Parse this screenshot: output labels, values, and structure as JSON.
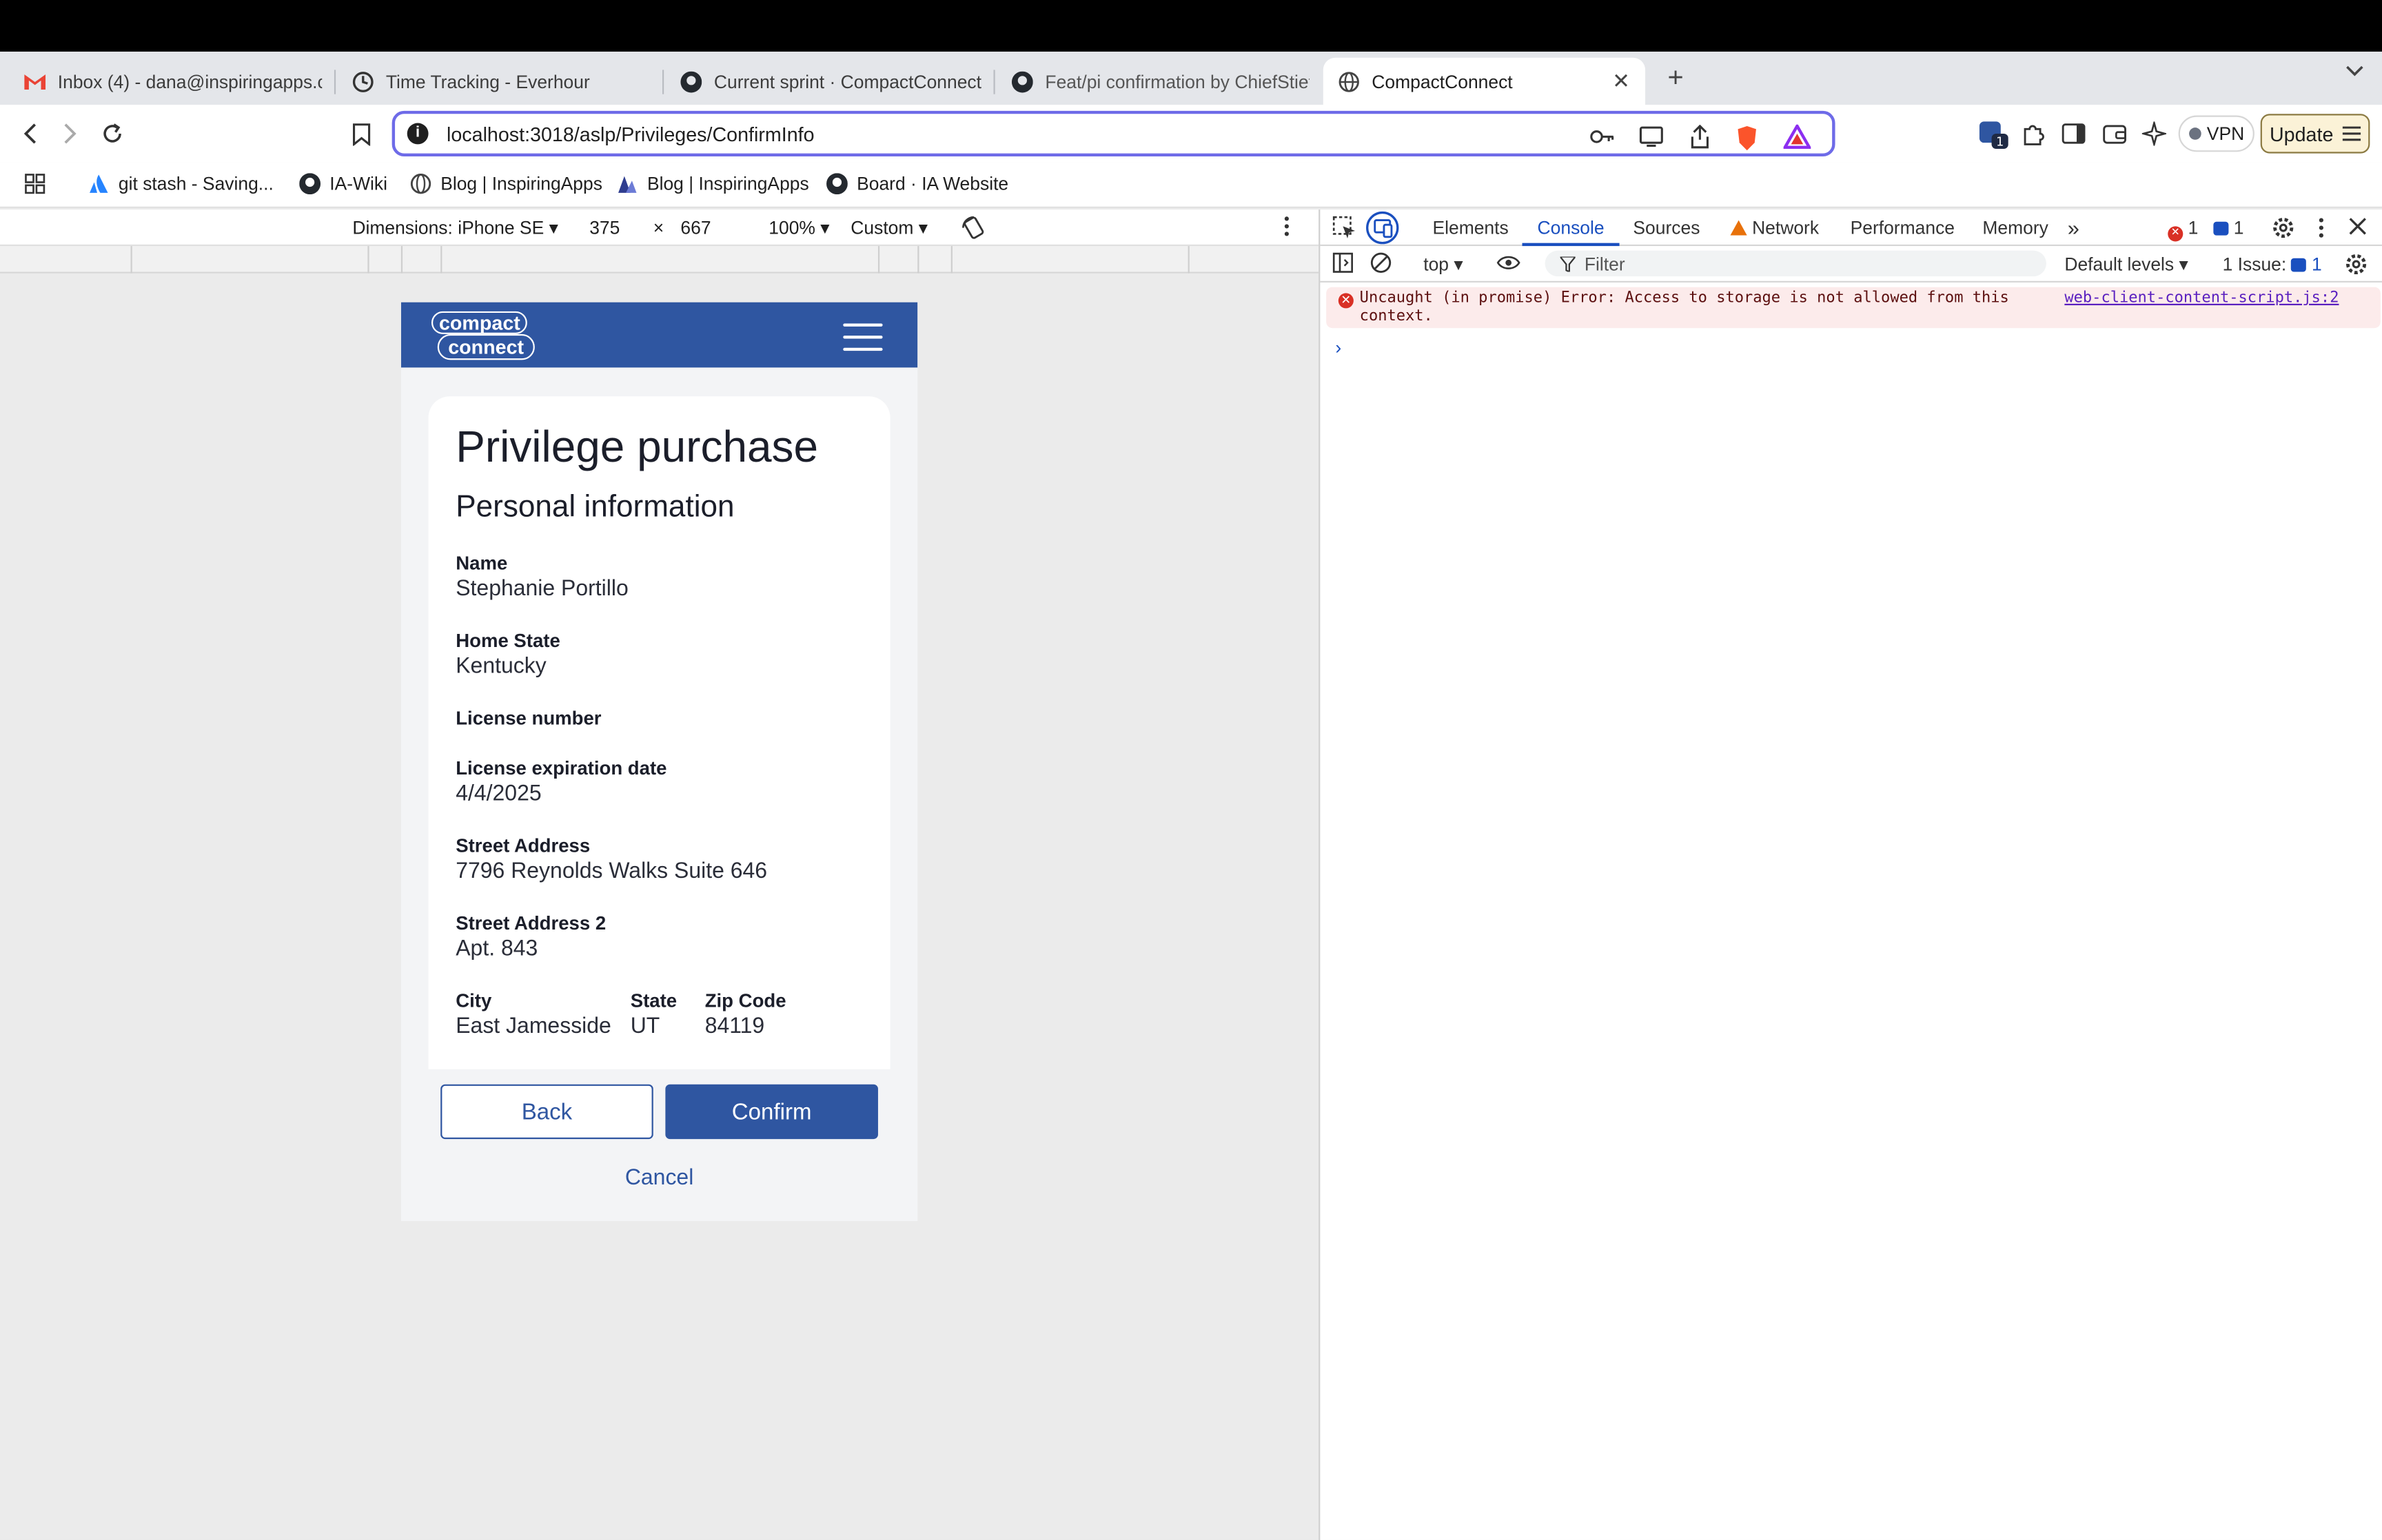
{
  "browser": {
    "tabs": [
      {
        "label": "Inbox (4) - dana@inspiringapps.c",
        "icon": "gmail-icon",
        "active": false
      },
      {
        "label": "Time Tracking - Everhour",
        "icon": "everhour-icon",
        "active": false
      },
      {
        "label": "Current sprint · CompactConnect",
        "icon": "github-icon",
        "active": false
      },
      {
        "label": "Feat/pi confirmation by ChiefStief",
        "icon": "github-icon",
        "active": false
      },
      {
        "label": "CompactConnect",
        "icon": "globe-icon",
        "active": true
      }
    ],
    "url": "localhost:3018/aslp/Privileges/ConfirmInfo",
    "bookmarks": [
      {
        "label": "git stash - Saving...",
        "icon": "atlassian-icon"
      },
      {
        "label": "IA-Wiki",
        "icon": "github-icon"
      },
      {
        "label": "Blog | InspiringApps",
        "icon": "globe-icon"
      },
      {
        "label": "Blog | InspiringApps",
        "icon": "inspiringapps-icon"
      },
      {
        "label": "Board · IA Website",
        "icon": "github-icon"
      }
    ],
    "vpn_label": "VPN",
    "update_label": "Update",
    "extension_badge": "1",
    "accent": "#6e6be8"
  },
  "device_toolbar": {
    "dimensions_label": "Dimensions: iPhone SE",
    "width": "375",
    "times": "×",
    "height": "667",
    "zoom": "100%",
    "throttle": "Custom"
  },
  "app": {
    "brand_line1": "compact",
    "brand_line2": "connect",
    "title": "Privilege purchase",
    "subtitle": "Personal information",
    "fields": [
      {
        "label": "Name",
        "value": "Stephanie Portillo"
      },
      {
        "label": "Home State",
        "value": "Kentucky"
      },
      {
        "label": "License number",
        "value": ""
      },
      {
        "label": "License expiration date",
        "value": "4/4/2025"
      },
      {
        "label": "Street Address",
        "value": "7796 Reynolds Walks Suite 646"
      },
      {
        "label": "Street Address 2",
        "value": "Apt. 843"
      }
    ],
    "address_row": [
      {
        "label": "City",
        "value": "East Jamesside"
      },
      {
        "label": "State",
        "value": "UT"
      },
      {
        "label": "Zip Code",
        "value": "84119"
      }
    ],
    "back_label": "Back",
    "confirm_label": "Confirm",
    "cancel_label": "Cancel",
    "brand_color": "#2f56a1"
  },
  "devtools": {
    "tabs": [
      "Elements",
      "Console",
      "Sources",
      "Network",
      "Performance",
      "Memory"
    ],
    "active_tab": "Console",
    "more_tabs": "»",
    "error_count": "1",
    "message_count": "1",
    "context": "top",
    "filter_placeholder": "Filter",
    "levels": "Default levels",
    "issues_label": "1 Issue:",
    "issues_count": "1",
    "error_message": "Uncaught (in promise) Error: Access to storage is not allowed from this context.",
    "error_source": "web-client-content-script.js:2",
    "prompt": "›"
  }
}
